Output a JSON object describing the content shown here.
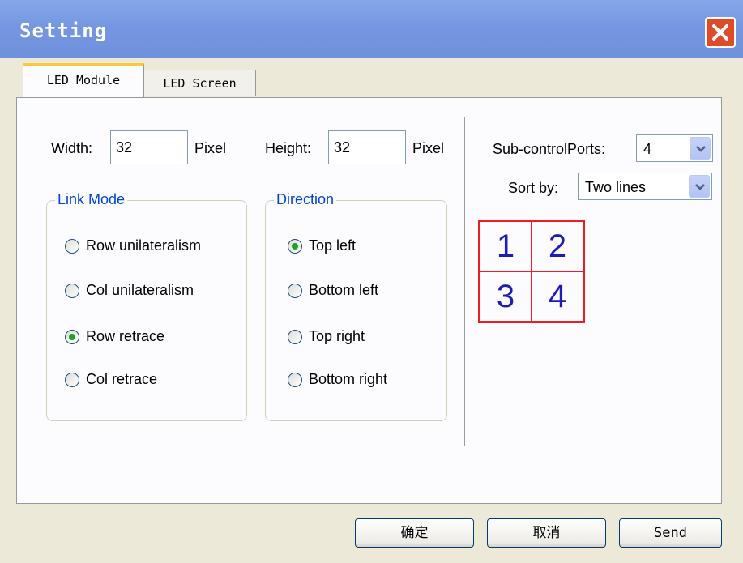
{
  "window": {
    "title": "Setting"
  },
  "tabs": [
    {
      "label": "LED Module",
      "active": true
    },
    {
      "label": "LED Screen",
      "active": false
    }
  ],
  "size": {
    "width_label": "Width:",
    "width_value": "32",
    "width_unit": "Pixel",
    "height_label": "Height:",
    "height_value": "32",
    "height_unit": "Pixel"
  },
  "link_mode": {
    "title": "Link Mode",
    "options": [
      {
        "label": "Row unilateralism",
        "checked": false
      },
      {
        "label": "Col unilateralism",
        "checked": false
      },
      {
        "label": "Row retrace",
        "checked": true
      },
      {
        "label": "Col retrace",
        "checked": false
      }
    ]
  },
  "direction": {
    "title": "Direction",
    "options": [
      {
        "label": "Top left",
        "checked": true
      },
      {
        "label": "Bottom left",
        "checked": false
      },
      {
        "label": "Top right",
        "checked": false
      },
      {
        "label": "Bottom right",
        "checked": false
      }
    ]
  },
  "ports": {
    "sub_control_label": "Sub-controlPorts:",
    "sub_control_value": "4",
    "sort_label": "Sort by:",
    "sort_value": "Two lines",
    "grid": [
      "1",
      "2",
      "3",
      "4"
    ]
  },
  "buttons": {
    "ok": "确定",
    "cancel": "取消",
    "send": "Send"
  },
  "colors": {
    "accent_green": "#21a121",
    "group_title_blue": "#0046d5",
    "grid_red": "#ee1c24",
    "grid_number_blue": "#1c1cb8"
  },
  "icons": {
    "close": "close-icon",
    "dropdown": "chevron-down-icon"
  }
}
